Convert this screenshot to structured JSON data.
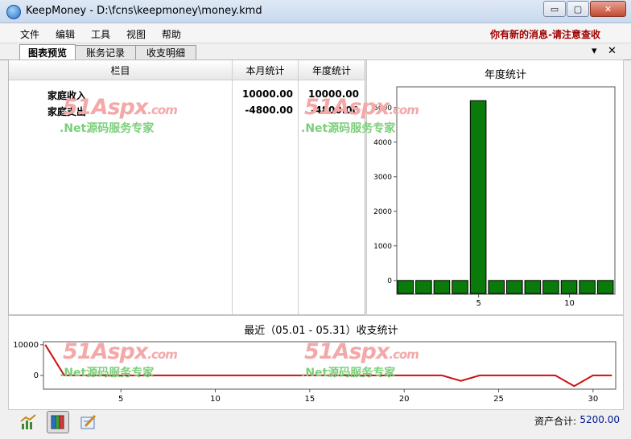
{
  "window": {
    "title": "KeepMoney - D:\\fcns\\keepmoney\\money.kmd",
    "minimize_glyph": "▭",
    "maximize_glyph": "▢",
    "close_glyph": "✕"
  },
  "menu": {
    "items": [
      "文件",
      "编辑",
      "工具",
      "视图",
      "帮助"
    ],
    "notice": "你有新的消息-请注意查收"
  },
  "tabs": {
    "items": [
      "图表预览",
      "账务记录",
      "收支明细"
    ],
    "active": 0,
    "dropdown_glyph": "▾",
    "close_glyph": "✕"
  },
  "table": {
    "columns": [
      "栏目",
      "本月统计",
      "年度统计"
    ],
    "rows": [
      {
        "label": "家庭收入",
        "month": "10000.00",
        "year": "10000.00"
      },
      {
        "label": "家庭支出",
        "month": "-4800.00",
        "year": "-4800.00"
      }
    ]
  },
  "watermark": {
    "logo": "51Aspx",
    "logo_suffix": ".com",
    "tagline": ".Net源码服务专家"
  },
  "chart_data": [
    {
      "type": "bar",
      "title": "年度统计",
      "categories": [
        1,
        2,
        3,
        4,
        5,
        6,
        7,
        8,
        9,
        10,
        11,
        12
      ],
      "values": [
        0,
        0,
        0,
        0,
        5200,
        0,
        0,
        0,
        0,
        0,
        0,
        0
      ],
      "ylim": [
        -400,
        5600
      ],
      "y_ticks": [
        0,
        1000,
        2000,
        3000,
        4000,
        5000
      ],
      "x_tick_labels": [
        5,
        10
      ],
      "color": "#0a7a0a"
    },
    {
      "type": "line",
      "title": "最近（05.01 - 05.31）收支统计",
      "x": [
        1,
        2,
        3,
        4,
        5,
        6,
        7,
        8,
        9,
        10,
        11,
        12,
        13,
        14,
        15,
        16,
        17,
        18,
        19,
        20,
        21,
        22,
        23,
        24,
        25,
        26,
        27,
        28,
        29,
        30,
        31
      ],
      "values": [
        10000,
        0,
        0,
        0,
        0,
        0,
        0,
        0,
        0,
        0,
        0,
        0,
        0,
        0,
        0,
        0,
        0,
        0,
        0,
        0,
        0,
        0,
        -1800,
        0,
        0,
        0,
        0,
        0,
        -3500,
        0,
        0
      ],
      "ylim": [
        -4500,
        11000
      ],
      "y_ticks": [
        0,
        10000
      ],
      "x_tick_labels": [
        5,
        10,
        15,
        20,
        25,
        30
      ],
      "color": "#cc1010"
    }
  ],
  "status": {
    "asset_label": "资产合计:",
    "asset_value": "5200.00"
  },
  "toolbar": {
    "icons": [
      "chart-trend-icon",
      "book-icon",
      "edit-icon"
    ]
  }
}
